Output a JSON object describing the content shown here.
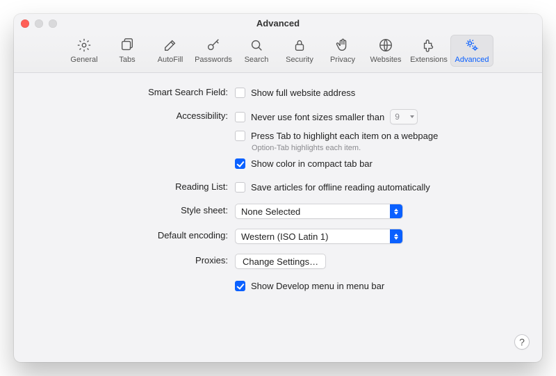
{
  "window": {
    "title": "Advanced"
  },
  "toolbar": {
    "items": [
      {
        "label": "General"
      },
      {
        "label": "Tabs"
      },
      {
        "label": "AutoFill"
      },
      {
        "label": "Passwords"
      },
      {
        "label": "Search"
      },
      {
        "label": "Security"
      },
      {
        "label": "Privacy"
      },
      {
        "label": "Websites"
      },
      {
        "label": "Extensions"
      },
      {
        "label": "Advanced"
      }
    ],
    "selected_index": 9
  },
  "sections": {
    "smart_search": {
      "label": "Smart Search Field:",
      "show_full_address": {
        "text": "Show full website address",
        "checked": false
      }
    },
    "accessibility": {
      "label": "Accessibility:",
      "font_min": {
        "text": "Never use font sizes smaller than",
        "checked": false,
        "value": "9"
      },
      "press_tab": {
        "text": "Press Tab to highlight each item on a webpage",
        "checked": false
      },
      "press_tab_hint": "Option-Tab highlights each item.",
      "compact_color": {
        "text": "Show color in compact tab bar",
        "checked": true
      }
    },
    "reading_list": {
      "label": "Reading List:",
      "save_offline": {
        "text": "Save articles for offline reading automatically",
        "checked": false
      }
    },
    "style_sheet": {
      "label": "Style sheet:",
      "value": "None Selected"
    },
    "default_encoding": {
      "label": "Default encoding:",
      "value": "Western (ISO Latin 1)"
    },
    "proxies": {
      "label": "Proxies:",
      "button": "Change Settings…"
    },
    "develop": {
      "text": "Show Develop menu in menu bar",
      "checked": true
    }
  },
  "help_glyph": "?"
}
